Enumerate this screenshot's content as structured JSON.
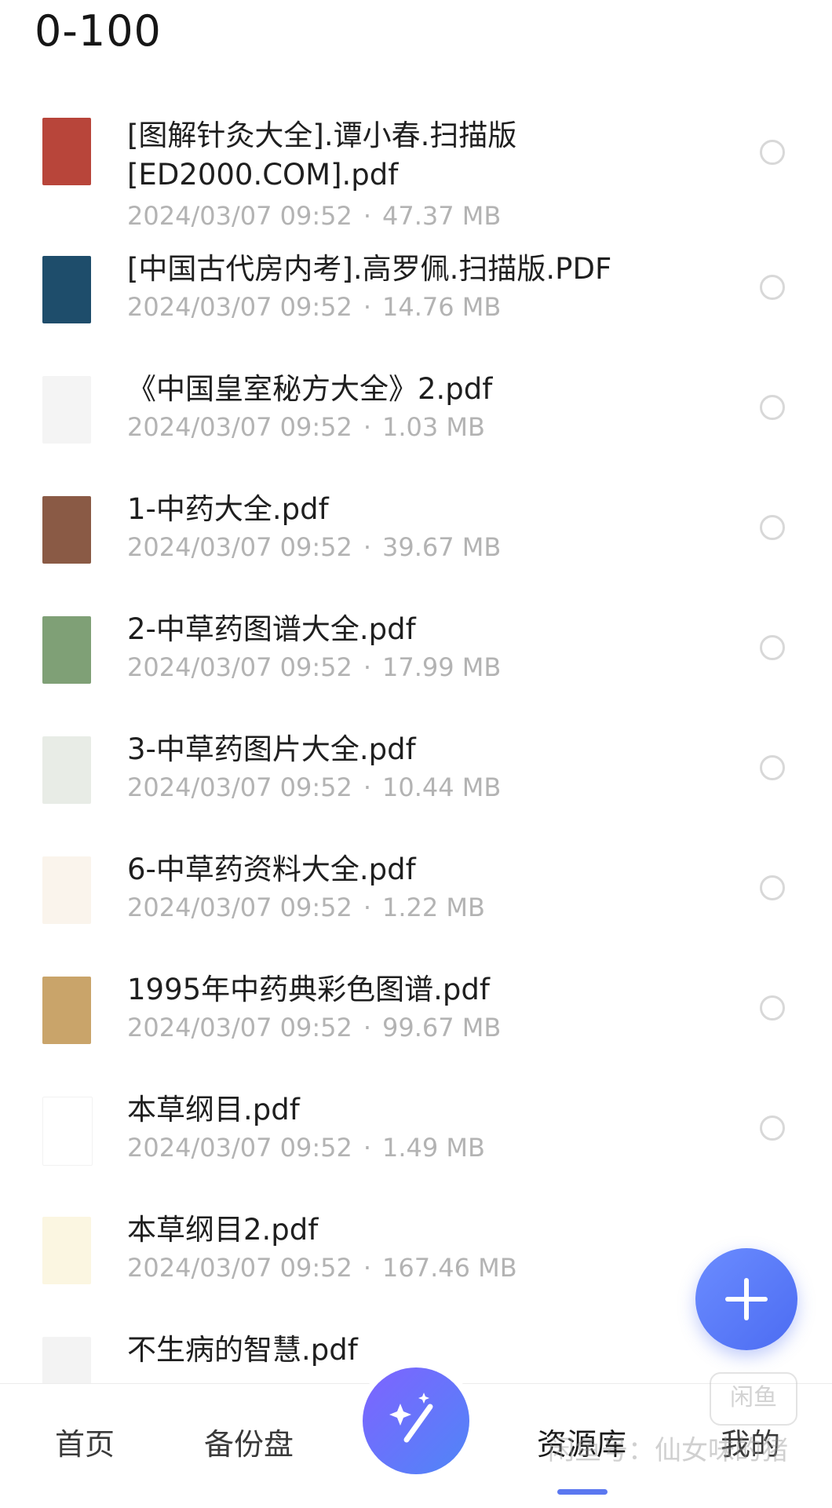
{
  "header": {
    "title": "0-100"
  },
  "files": [
    {
      "name": "[图解针灸大全].谭小春.扫描版[ED2000.COM].pdf",
      "date": "2024/03/07 09:52",
      "size": "47.37 MB",
      "thumb_color": "#b8453a"
    },
    {
      "name": "[中国古代房内考].高罗佩.扫描版.PDF",
      "date": "2024/03/07 09:52",
      "size": "14.76 MB",
      "thumb_color": "#1e4d6b"
    },
    {
      "name": "《中国皇室秘方大全》2.pdf",
      "date": "2024/03/07 09:52",
      "size": "1.03 MB",
      "thumb_color": "#f4f4f4"
    },
    {
      "name": "1-中药大全.pdf",
      "date": "2024/03/07 09:52",
      "size": "39.67 MB",
      "thumb_color": "#8a5a45"
    },
    {
      "name": "2-中草药图谱大全.pdf",
      "date": "2024/03/07 09:52",
      "size": "17.99 MB",
      "thumb_color": "#7fa076"
    },
    {
      "name": "3-中草药图片大全.pdf",
      "date": "2024/03/07 09:52",
      "size": "10.44 MB",
      "thumb_color": "#e8ece6"
    },
    {
      "name": "6-中草药资料大全.pdf",
      "date": "2024/03/07 09:52",
      "size": "1.22 MB",
      "thumb_color": "#faf4ec"
    },
    {
      "name": "1995年中药典彩色图谱.pdf",
      "date": "2024/03/07 09:52",
      "size": "99.67 MB",
      "thumb_color": "#c9a46a"
    },
    {
      "name": "本草纲目.pdf",
      "date": "2024/03/07 09:52",
      "size": "1.49 MB",
      "thumb_color": "#ffffff"
    },
    {
      "name": "本草纲目2.pdf",
      "date": "2024/03/07 09:52",
      "size": "167.46 MB",
      "thumb_color": "#fbf6e1"
    },
    {
      "name": "不生病的智慧.pdf",
      "date": "",
      "size": "",
      "thumb_color": "#f3f3f3"
    }
  ],
  "fab": {
    "icon": "plus-icon"
  },
  "bottom_nav": {
    "items": [
      "首页",
      "备份盘",
      "资源库",
      "我的"
    ],
    "center_icon": "magic-wand-icon",
    "active_index": 2
  },
  "watermark": {
    "text": "闲鱼号：仙女味的猪",
    "logo_text": "闲鱼"
  },
  "colors": {
    "accent": "#5b78f0",
    "meta_text": "#b3b3b3"
  }
}
